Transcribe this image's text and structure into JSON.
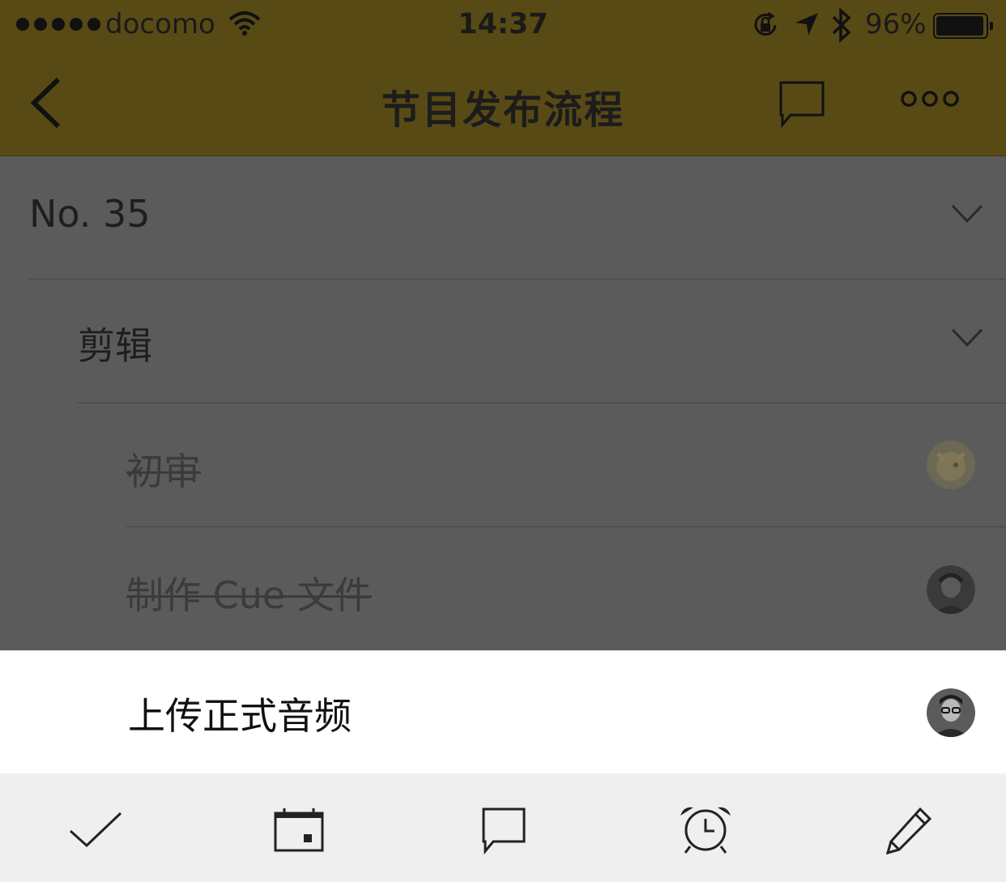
{
  "status_bar": {
    "carrier": "docomo",
    "time": "14:37",
    "battery": "96%",
    "battery_level": 0.96,
    "icons": [
      "signal-dots",
      "wifi-icon",
      "rotation-lock-icon",
      "location-arrow-icon",
      "bluetooth-icon",
      "battery-icon"
    ]
  },
  "nav": {
    "title": "节目发布流程",
    "icons": [
      "back-chevron-icon",
      "comment-icon",
      "more-icon"
    ],
    "bar_color": "#584a15"
  },
  "list": {
    "project": {
      "label": "No. 35",
      "icon": "chevron-down-icon"
    },
    "section": {
      "label": "剪辑",
      "icon": "chevron-down-icon"
    },
    "tasks": [
      {
        "label": "初审",
        "done": true,
        "avatar": "avatar-icon"
      },
      {
        "label": "制作 Cue 文件",
        "done": true,
        "avatar": "avatar-icon"
      }
    ]
  },
  "selected_task": {
    "label": "上传正式音频",
    "done": false,
    "avatar": "avatar-icon"
  },
  "toolbar": {
    "actions": [
      "check-icon",
      "calendar-icon",
      "comment-icon",
      "alarm-clock-icon",
      "pencil-icon"
    ]
  },
  "colors": {
    "overlay": "#5b5b5b",
    "sheet": "#ffffff",
    "toolbar": "#efefef"
  }
}
